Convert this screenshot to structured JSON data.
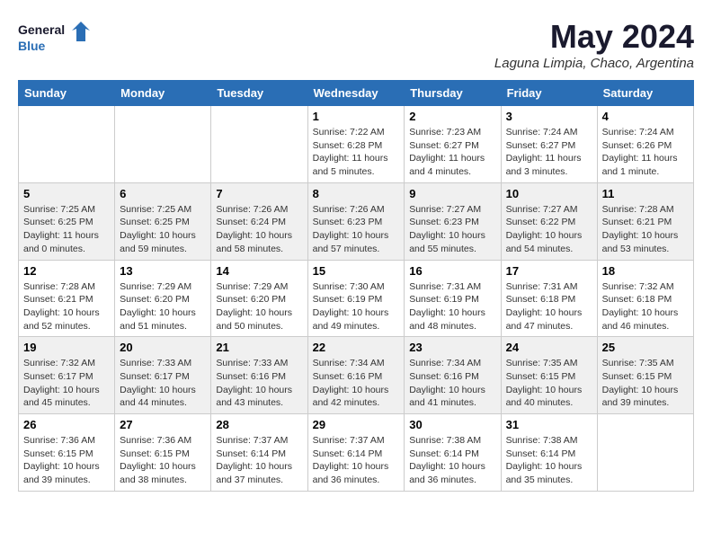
{
  "logo": {
    "line1": "General",
    "line2": "Blue"
  },
  "title": "May 2024",
  "subtitle": "Laguna Limpia, Chaco, Argentina",
  "days_of_week": [
    "Sunday",
    "Monday",
    "Tuesday",
    "Wednesday",
    "Thursday",
    "Friday",
    "Saturday"
  ],
  "weeks": [
    [
      {
        "day": "",
        "info": ""
      },
      {
        "day": "",
        "info": ""
      },
      {
        "day": "",
        "info": ""
      },
      {
        "day": "1",
        "info": "Sunrise: 7:22 AM\nSunset: 6:28 PM\nDaylight: 11 hours\nand 5 minutes."
      },
      {
        "day": "2",
        "info": "Sunrise: 7:23 AM\nSunset: 6:27 PM\nDaylight: 11 hours\nand 4 minutes."
      },
      {
        "day": "3",
        "info": "Sunrise: 7:24 AM\nSunset: 6:27 PM\nDaylight: 11 hours\nand 3 minutes."
      },
      {
        "day": "4",
        "info": "Sunrise: 7:24 AM\nSunset: 6:26 PM\nDaylight: 11 hours\nand 1 minute."
      }
    ],
    [
      {
        "day": "5",
        "info": "Sunrise: 7:25 AM\nSunset: 6:25 PM\nDaylight: 11 hours\nand 0 minutes."
      },
      {
        "day": "6",
        "info": "Sunrise: 7:25 AM\nSunset: 6:25 PM\nDaylight: 10 hours\nand 59 minutes."
      },
      {
        "day": "7",
        "info": "Sunrise: 7:26 AM\nSunset: 6:24 PM\nDaylight: 10 hours\nand 58 minutes."
      },
      {
        "day": "8",
        "info": "Sunrise: 7:26 AM\nSunset: 6:23 PM\nDaylight: 10 hours\nand 57 minutes."
      },
      {
        "day": "9",
        "info": "Sunrise: 7:27 AM\nSunset: 6:23 PM\nDaylight: 10 hours\nand 55 minutes."
      },
      {
        "day": "10",
        "info": "Sunrise: 7:27 AM\nSunset: 6:22 PM\nDaylight: 10 hours\nand 54 minutes."
      },
      {
        "day": "11",
        "info": "Sunrise: 7:28 AM\nSunset: 6:21 PM\nDaylight: 10 hours\nand 53 minutes."
      }
    ],
    [
      {
        "day": "12",
        "info": "Sunrise: 7:28 AM\nSunset: 6:21 PM\nDaylight: 10 hours\nand 52 minutes."
      },
      {
        "day": "13",
        "info": "Sunrise: 7:29 AM\nSunset: 6:20 PM\nDaylight: 10 hours\nand 51 minutes."
      },
      {
        "day": "14",
        "info": "Sunrise: 7:29 AM\nSunset: 6:20 PM\nDaylight: 10 hours\nand 50 minutes."
      },
      {
        "day": "15",
        "info": "Sunrise: 7:30 AM\nSunset: 6:19 PM\nDaylight: 10 hours\nand 49 minutes."
      },
      {
        "day": "16",
        "info": "Sunrise: 7:31 AM\nSunset: 6:19 PM\nDaylight: 10 hours\nand 48 minutes."
      },
      {
        "day": "17",
        "info": "Sunrise: 7:31 AM\nSunset: 6:18 PM\nDaylight: 10 hours\nand 47 minutes."
      },
      {
        "day": "18",
        "info": "Sunrise: 7:32 AM\nSunset: 6:18 PM\nDaylight: 10 hours\nand 46 minutes."
      }
    ],
    [
      {
        "day": "19",
        "info": "Sunrise: 7:32 AM\nSunset: 6:17 PM\nDaylight: 10 hours\nand 45 minutes."
      },
      {
        "day": "20",
        "info": "Sunrise: 7:33 AM\nSunset: 6:17 PM\nDaylight: 10 hours\nand 44 minutes."
      },
      {
        "day": "21",
        "info": "Sunrise: 7:33 AM\nSunset: 6:16 PM\nDaylight: 10 hours\nand 43 minutes."
      },
      {
        "day": "22",
        "info": "Sunrise: 7:34 AM\nSunset: 6:16 PM\nDaylight: 10 hours\nand 42 minutes."
      },
      {
        "day": "23",
        "info": "Sunrise: 7:34 AM\nSunset: 6:16 PM\nDaylight: 10 hours\nand 41 minutes."
      },
      {
        "day": "24",
        "info": "Sunrise: 7:35 AM\nSunset: 6:15 PM\nDaylight: 10 hours\nand 40 minutes."
      },
      {
        "day": "25",
        "info": "Sunrise: 7:35 AM\nSunset: 6:15 PM\nDaylight: 10 hours\nand 39 minutes."
      }
    ],
    [
      {
        "day": "26",
        "info": "Sunrise: 7:36 AM\nSunset: 6:15 PM\nDaylight: 10 hours\nand 39 minutes."
      },
      {
        "day": "27",
        "info": "Sunrise: 7:36 AM\nSunset: 6:15 PM\nDaylight: 10 hours\nand 38 minutes."
      },
      {
        "day": "28",
        "info": "Sunrise: 7:37 AM\nSunset: 6:14 PM\nDaylight: 10 hours\nand 37 minutes."
      },
      {
        "day": "29",
        "info": "Sunrise: 7:37 AM\nSunset: 6:14 PM\nDaylight: 10 hours\nand 36 minutes."
      },
      {
        "day": "30",
        "info": "Sunrise: 7:38 AM\nSunset: 6:14 PM\nDaylight: 10 hours\nand 36 minutes."
      },
      {
        "day": "31",
        "info": "Sunrise: 7:38 AM\nSunset: 6:14 PM\nDaylight: 10 hours\nand 35 minutes."
      },
      {
        "day": "",
        "info": ""
      }
    ]
  ]
}
